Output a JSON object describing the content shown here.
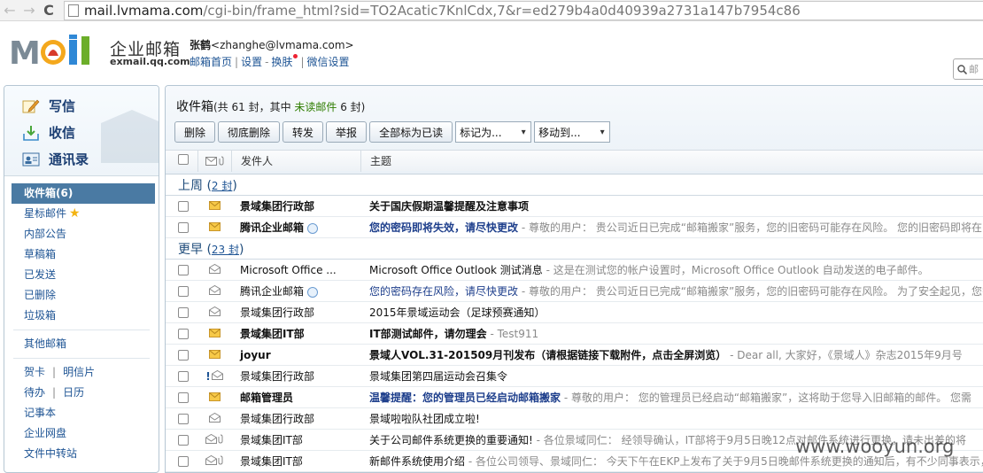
{
  "browser": {
    "back_glyph": "←",
    "forward_glyph": "→",
    "reload_glyph": "C",
    "url_host": "mail.lvmama.com",
    "url_path": "/cgi-bin/frame_html?sid=TO2Acatic7KnlCdx,7&r=ed279b4a0d40939a2731a147b7954c86"
  },
  "header": {
    "logo_cn": "企业邮箱",
    "logo_en": "exmail.qq.com",
    "user_name": "张鹤",
    "user_email": "<zhanghe@lvmama.com>",
    "links": [
      "邮箱首页",
      "设置",
      "换肤",
      "微信设置"
    ],
    "link_separators": [
      "|",
      "-",
      "|"
    ],
    "search_placeholder": "邮"
  },
  "sidebar": {
    "quick": [
      {
        "label": "写信",
        "icon": "compose-icon"
      },
      {
        "label": "收信",
        "icon": "receive-icon"
      },
      {
        "label": "通讯录",
        "icon": "contacts-icon"
      }
    ],
    "folders_main": [
      {
        "label": "收件箱(6)",
        "active": true
      },
      {
        "label": "星标邮件",
        "star": "★"
      },
      {
        "label": "内部公告"
      },
      {
        "label": "草稿箱"
      },
      {
        "label": "已发送"
      },
      {
        "label": "已删除"
      },
      {
        "label": "垃圾箱"
      }
    ],
    "folders_other": [
      {
        "label": "其他邮箱"
      }
    ],
    "tools": [
      {
        "left": "贺卡",
        "sep": "|",
        "right": "明信片"
      },
      {
        "left": "待办",
        "sep": "|",
        "right": "日历"
      },
      {
        "left": "记事本"
      },
      {
        "left": "企业网盘"
      },
      {
        "left": "文件中转站"
      }
    ]
  },
  "main": {
    "title": "收件箱",
    "count_prefix": "(共 61 封，其中 ",
    "unread_label": "未读邮件",
    "count_suffix": " 6 封)",
    "toolbar": {
      "delete": "删除",
      "delete_forever": "彻底删除",
      "forward": "转发",
      "report": "举报",
      "mark_all_read": "全部标为已读",
      "mark_as": "标记为...",
      "move_to": "移动到...",
      "select_arrow": "▾"
    },
    "columns": {
      "sender": "发件人",
      "subject": "主题"
    },
    "groups": [
      {
        "label": "上周",
        "count": "2 封",
        "rows": [
          {
            "sender": "景域集团行政部",
            "subject": "关于国庆假期温馨提醒及注意事项",
            "preview": "",
            "unread": true,
            "qq": false,
            "blue": false,
            "bang": false,
            "clip": false
          },
          {
            "sender": "腾讯企业邮箱",
            "subject": "您的密码即将失效，请尽快更改",
            "preview": " - 尊敬的用户：  贵公司近日已完成“邮箱搬家”服务，您的旧密码可能存在风险。  您的旧密码即将在",
            "unread": true,
            "qq": true,
            "blue": true,
            "bang": false,
            "clip": false
          }
        ]
      },
      {
        "label": "更早",
        "count": "23 封",
        "rows": [
          {
            "sender": "Microsoft Office ...",
            "subject": "Microsoft Office Outlook 测试消息",
            "preview": " - 这是在测试您的帐户设置时，Microsoft Office Outlook 自动发送的电子邮件。",
            "unread": false,
            "qq": false,
            "blue": false,
            "bang": false,
            "clip": false
          },
          {
            "sender": "腾讯企业邮箱",
            "subject": "您的密码存在风险，请尽快更改",
            "preview": " - 尊敬的用户：  贵公司近日已完成“邮箱搬家”服务，您的旧密码可能存在风险。  为了安全起见，您需",
            "unread": false,
            "qq": true,
            "blue": true,
            "bang": false,
            "clip": false
          },
          {
            "sender": "景域集团行政部",
            "subject": "2015年景域运动会（足球预赛通知）",
            "preview": "",
            "unread": false,
            "qq": false,
            "blue": false,
            "bang": false,
            "clip": false
          },
          {
            "sender": "景域集团IT部",
            "subject": "IT部测试邮件，请勿理会",
            "preview": " - Test911",
            "unread": true,
            "qq": false,
            "blue": false,
            "bang": false,
            "clip": false
          },
          {
            "sender": "joyur",
            "subject": "景域人VOL.31-201509月刊发布（请根据链接下载附件，点击全屏浏览）",
            "preview": " - Dear all, 大家好，《景域人》杂志2015年9月号",
            "unread": true,
            "qq": false,
            "blue": false,
            "bang": false,
            "clip": false
          },
          {
            "sender": "景域集团行政部",
            "subject": "景域集团第四届运动会召集令",
            "preview": "",
            "unread": false,
            "qq": false,
            "blue": false,
            "bang": true,
            "clip": false
          },
          {
            "sender": "邮箱管理员",
            "subject": "温馨提醒：您的管理员已经启动邮箱搬家",
            "preview": " - 尊敬的用户：  您的管理员已经启动“邮箱搬家”，这将助于您导入旧邮箱的邮件。  您需",
            "unread": true,
            "qq": false,
            "blue": true,
            "bang": false,
            "clip": false
          },
          {
            "sender": "景域集团行政部",
            "subject": "景域啦啦队社团成立啦!",
            "preview": "",
            "unread": false,
            "qq": false,
            "blue": false,
            "bang": false,
            "clip": false
          },
          {
            "sender": "景域集团IT部",
            "subject": "关于公司邮件系统更换的重要通知!",
            "preview": " - 各位景域同仁：  经领导确认，IT部将于9月5日晚12点对邮件系统进行更换，请未出差的将",
            "unread": false,
            "qq": false,
            "blue": false,
            "bang": false,
            "clip": true
          },
          {
            "sender": "景域集团IT部",
            "subject": "新邮件系统使用介绍",
            "preview": " - 各位公司领导、景域同仁：  今天下午在EKP上发布了关于9月5日晚邮件系统更换的通知后，有不少同事表示，通",
            "unread": false,
            "qq": false,
            "blue": false,
            "bang": false,
            "clip": true
          }
        ]
      }
    ]
  },
  "watermark": "www.wooyun.org",
  "colors": {
    "accent": "#4a7aa3",
    "unread_green": "#2e7d00",
    "link_blue": "#1e5494"
  }
}
